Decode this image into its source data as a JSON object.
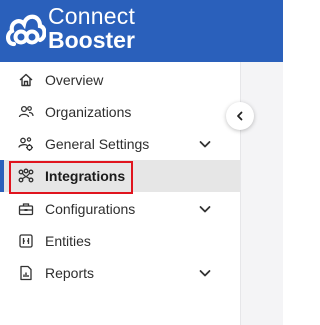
{
  "brand": {
    "line1": "Connect",
    "line2": "Booster",
    "logo_icon": "cloud-link-logo-icon",
    "primary_color": "#2a60bb"
  },
  "sidebar": {
    "items": [
      {
        "label": "Overview",
        "icon": "home-icon",
        "expandable": false
      },
      {
        "label": "Organizations",
        "icon": "users-icon",
        "expandable": false
      },
      {
        "label": "General Settings",
        "icon": "users-gear-icon",
        "expandable": true
      },
      {
        "label": "Integrations",
        "icon": "nodes-icon",
        "expandable": false,
        "active": true
      },
      {
        "label": "Configurations",
        "icon": "toolbox-icon",
        "expandable": true
      },
      {
        "label": "Entities",
        "icon": "entities-icon",
        "expandable": false
      },
      {
        "label": "Reports",
        "icon": "report-icon",
        "expandable": true
      }
    ]
  },
  "collapse_button_icon": "chevron-left-icon",
  "highlight_color": "#e0141e"
}
